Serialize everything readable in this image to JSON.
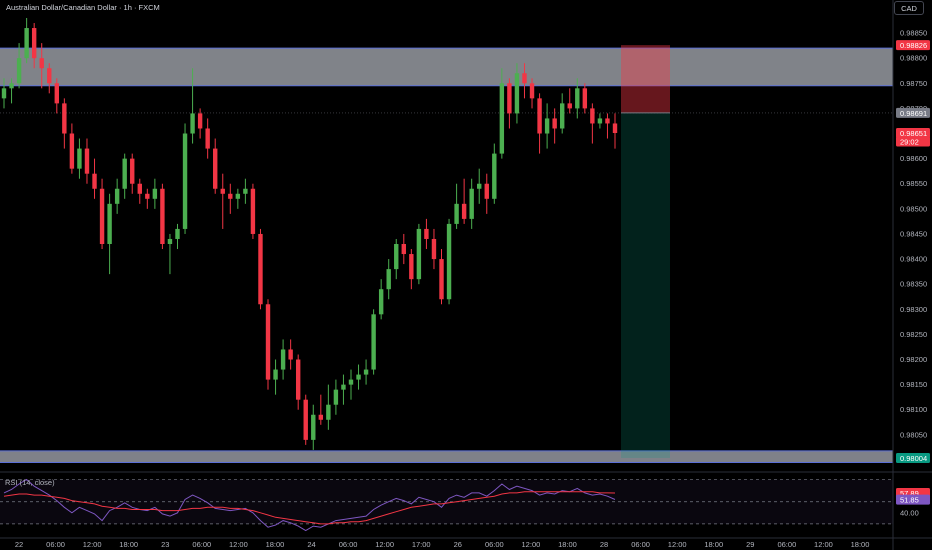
{
  "header": {
    "title": "Australian Dollar/Canadian Dollar · 1h · FXCM",
    "currency": "CAD"
  },
  "chart_data": {
    "type": "candlestick",
    "symbol": "AUDCAD",
    "interval": "1h",
    "ylim": [
      0.9798,
      0.9888
    ],
    "y_ticks": [
      "0.98850",
      "0.98800",
      "0.98750",
      "0.98700",
      "0.98650",
      "0.98600",
      "0.98550",
      "0.98500",
      "0.98450",
      "0.98400",
      "0.98350",
      "0.98300",
      "0.98250",
      "0.98200",
      "0.98150",
      "0.98100",
      "0.98050"
    ],
    "x_ticks": [
      "22",
      "06:00",
      "12:00",
      "18:00",
      "23",
      "06:00",
      "12:00",
      "18:00",
      "24",
      "06:00",
      "12:00",
      "17:00",
      "26",
      "06:00",
      "12:00",
      "18:00",
      "28",
      "06:00",
      "12:00",
      "18:00",
      "29",
      "06:00",
      "12:00",
      "18:00"
    ],
    "price_tags": [
      {
        "label": "0.98826",
        "value": 0.98826,
        "color": "#f23645"
      },
      {
        "label": "0.98691",
        "value": 0.98691,
        "color": "#787b86"
      },
      {
        "label": "0.98651",
        "value": 0.98651,
        "color": "#f23645"
      },
      {
        "label": "29:02",
        "value": 0.98634,
        "color": "#f23645"
      },
      {
        "label": "0.98004",
        "value": 0.98004,
        "color": "#089981"
      }
    ],
    "zones": [
      {
        "kind": "resistance",
        "from": 0.98745,
        "to": 0.9882
      },
      {
        "kind": "support",
        "from": 0.97995,
        "to": 0.98018
      }
    ],
    "short_position": {
      "entry": 0.98691,
      "stop": 0.98826,
      "target": 0.98004
    },
    "candles": [
      [
        0.9872,
        0.9876,
        0.987,
        0.9874
      ],
      [
        0.9874,
        0.9876,
        0.9871,
        0.9875
      ],
      [
        0.9875,
        0.9883,
        0.9874,
        0.988
      ],
      [
        0.988,
        0.9888,
        0.9879,
        0.9886
      ],
      [
        0.9886,
        0.9887,
        0.9878,
        0.988
      ],
      [
        0.988,
        0.9883,
        0.9874,
        0.9878
      ],
      [
        0.9878,
        0.9879,
        0.9873,
        0.9875
      ],
      [
        0.9875,
        0.9876,
        0.9869,
        0.9871
      ],
      [
        0.9871,
        0.9872,
        0.9862,
        0.9865
      ],
      [
        0.9865,
        0.9867,
        0.9857,
        0.9858
      ],
      [
        0.9858,
        0.9864,
        0.9856,
        0.9862
      ],
      [
        0.9862,
        0.9864,
        0.9855,
        0.9857
      ],
      [
        0.9857,
        0.986,
        0.9852,
        0.9854
      ],
      [
        0.9854,
        0.9856,
        0.9842,
        0.9843
      ],
      [
        0.9843,
        0.9853,
        0.9837,
        0.9851
      ],
      [
        0.9851,
        0.9856,
        0.9849,
        0.9854
      ],
      [
        0.9854,
        0.9861,
        0.9852,
        0.986
      ],
      [
        0.986,
        0.9861,
        0.9853,
        0.9855
      ],
      [
        0.9855,
        0.9856,
        0.9851,
        0.9853
      ],
      [
        0.9853,
        0.9854,
        0.985,
        0.9852
      ],
      [
        0.9852,
        0.9856,
        0.985,
        0.9854
      ],
      [
        0.9854,
        0.9855,
        0.9842,
        0.9843
      ],
      [
        0.9843,
        0.9845,
        0.9837,
        0.9844
      ],
      [
        0.9844,
        0.9847,
        0.9842,
        0.9846
      ],
      [
        0.9846,
        0.9867,
        0.9845,
        0.9865
      ],
      [
        0.9865,
        0.9878,
        0.9863,
        0.9869
      ],
      [
        0.9869,
        0.987,
        0.9864,
        0.9866
      ],
      [
        0.9866,
        0.9868,
        0.986,
        0.9862
      ],
      [
        0.9862,
        0.9864,
        0.9853,
        0.9854
      ],
      [
        0.9854,
        0.9857,
        0.9846,
        0.9853
      ],
      [
        0.9853,
        0.9855,
        0.9849,
        0.9852
      ],
      [
        0.9852,
        0.9854,
        0.985,
        0.9853
      ],
      [
        0.9853,
        0.9856,
        0.9851,
        0.9854
      ],
      [
        0.9854,
        0.9855,
        0.9844,
        0.9845
      ],
      [
        0.9845,
        0.9846,
        0.983,
        0.9831
      ],
      [
        0.9831,
        0.9832,
        0.9814,
        0.9816
      ],
      [
        0.9816,
        0.982,
        0.9813,
        0.9818
      ],
      [
        0.9818,
        0.9824,
        0.9816,
        0.9822
      ],
      [
        0.9822,
        0.9824,
        0.9818,
        0.982
      ],
      [
        0.982,
        0.9821,
        0.981,
        0.9812
      ],
      [
        0.9812,
        0.9813,
        0.9803,
        0.9804
      ],
      [
        0.9804,
        0.9811,
        0.9802,
        0.9809
      ],
      [
        0.9809,
        0.9813,
        0.9807,
        0.9808
      ],
      [
        0.9808,
        0.9815,
        0.9806,
        0.9811
      ],
      [
        0.9811,
        0.9816,
        0.9809,
        0.9814
      ],
      [
        0.9814,
        0.9817,
        0.9811,
        0.9815
      ],
      [
        0.9815,
        0.9818,
        0.9812,
        0.9816
      ],
      [
        0.9816,
        0.9819,
        0.9814,
        0.9817
      ],
      [
        0.9817,
        0.982,
        0.9815,
        0.9818
      ],
      [
        0.9818,
        0.983,
        0.9817,
        0.9829
      ],
      [
        0.9829,
        0.9836,
        0.9828,
        0.9834
      ],
      [
        0.9834,
        0.984,
        0.9832,
        0.9838
      ],
      [
        0.9838,
        0.9844,
        0.9836,
        0.9843
      ],
      [
        0.9843,
        0.9845,
        0.9839,
        0.9841
      ],
      [
        0.9841,
        0.9842,
        0.9834,
        0.9836
      ],
      [
        0.9836,
        0.9847,
        0.9835,
        0.9846
      ],
      [
        0.9846,
        0.9848,
        0.9842,
        0.9844
      ],
      [
        0.9844,
        0.9846,
        0.9838,
        0.984
      ],
      [
        0.984,
        0.9842,
        0.9831,
        0.9832
      ],
      [
        0.9832,
        0.9848,
        0.9831,
        0.9847
      ],
      [
        0.9847,
        0.9855,
        0.9846,
        0.9851
      ],
      [
        0.9851,
        0.9856,
        0.9847,
        0.9848
      ],
      [
        0.9848,
        0.9856,
        0.9846,
        0.9854
      ],
      [
        0.9854,
        0.9858,
        0.9851,
        0.9855
      ],
      [
        0.9855,
        0.9857,
        0.9849,
        0.9852
      ],
      [
        0.9852,
        0.9863,
        0.9851,
        0.9861
      ],
      [
        0.9861,
        0.9878,
        0.986,
        0.9875
      ],
      [
        0.9875,
        0.9876,
        0.9866,
        0.9869
      ],
      [
        0.9869,
        0.9879,
        0.9867,
        0.9877
      ],
      [
        0.9877,
        0.9879,
        0.9872,
        0.9875
      ],
      [
        0.9875,
        0.9876,
        0.987,
        0.9872
      ],
      [
        0.9872,
        0.9873,
        0.9861,
        0.9865
      ],
      [
        0.9865,
        0.9871,
        0.9862,
        0.9868
      ],
      [
        0.9868,
        0.987,
        0.9863,
        0.9866
      ],
      [
        0.9866,
        0.9873,
        0.9865,
        0.9871
      ],
      [
        0.9871,
        0.9874,
        0.9869,
        0.987
      ],
      [
        0.987,
        0.9876,
        0.9868,
        0.9874
      ],
      [
        0.9874,
        0.9875,
        0.9869,
        0.987
      ],
      [
        0.987,
        0.9871,
        0.9863,
        0.9867
      ],
      [
        0.9867,
        0.9869,
        0.9866,
        0.9868
      ],
      [
        0.9868,
        0.9869,
        0.9864,
        0.9867
      ],
      [
        0.9867,
        0.9869,
        0.9862,
        0.98651
      ]
    ],
    "rsi": {
      "label": "RSI (14, close)",
      "ylim": [
        20,
        75
      ],
      "levels": [
        70,
        50,
        30
      ],
      "y_ticks": [
        "40.00"
      ],
      "last_rsi": "51.85",
      "last_ma": "57.89",
      "values": [
        58,
        61,
        66,
        70,
        64,
        60,
        56,
        51,
        45,
        40,
        45,
        42,
        39,
        33,
        42,
        45,
        49,
        45,
        43,
        42,
        45,
        39,
        37,
        40,
        52,
        56,
        53,
        49,
        44,
        43,
        42,
        43,
        44,
        40,
        33,
        27,
        29,
        33,
        31,
        28,
        24,
        28,
        27,
        30,
        33,
        34,
        35,
        36,
        37,
        43,
        47,
        50,
        53,
        51,
        48,
        54,
        52,
        50,
        45,
        53,
        56,
        54,
        58,
        58,
        55,
        60,
        66,
        61,
        64,
        62,
        60,
        56,
        58,
        57,
        60,
        59,
        62,
        58,
        56,
        57,
        55,
        52
      ],
      "ma": [
        55,
        56,
        57,
        57,
        56,
        56,
        55,
        54,
        53,
        51,
        50,
        49,
        48,
        46,
        45,
        44,
        44,
        43,
        43,
        43,
        43,
        42,
        42,
        42,
        43,
        44,
        44,
        45,
        45,
        45,
        44,
        44,
        43,
        42,
        40,
        38,
        36,
        35,
        34,
        33,
        32,
        31,
        30,
        30,
        31,
        31,
        32,
        32,
        33,
        35,
        37,
        39,
        41,
        43,
        45,
        46,
        47,
        48,
        48,
        49,
        50,
        51,
        52,
        53,
        54,
        55,
        57,
        58,
        58,
        59,
        59,
        59,
        59,
        59,
        59,
        59,
        59,
        59,
        59,
        58,
        58,
        57.89
      ]
    }
  }
}
